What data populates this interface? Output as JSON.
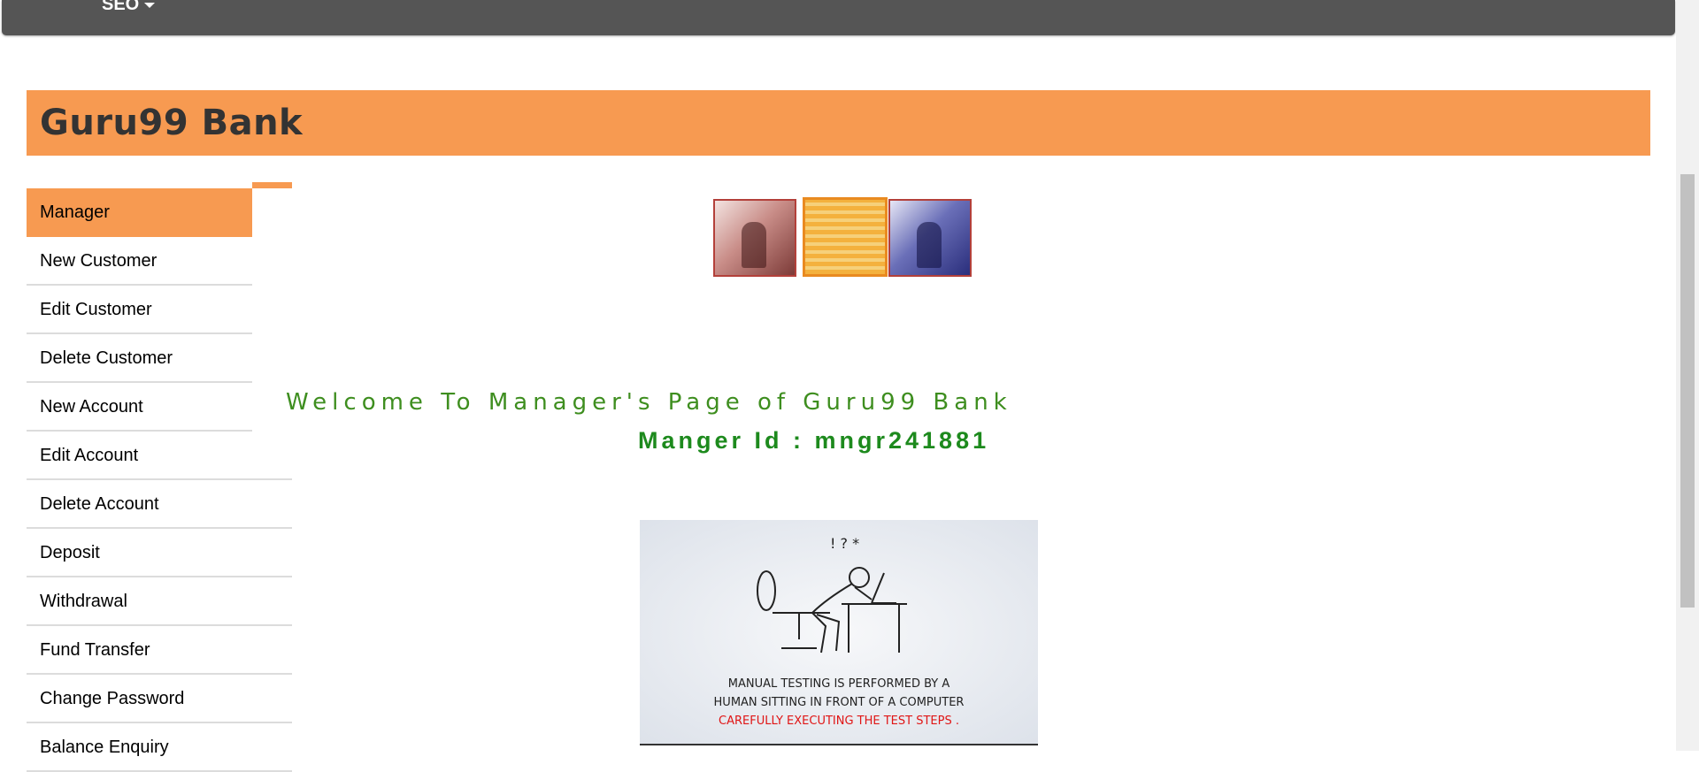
{
  "topnav": {
    "menu_label": "SEO"
  },
  "banner": {
    "brand": "Guru99 Bank"
  },
  "sidebar": {
    "items": [
      {
        "label": "Manager"
      },
      {
        "label": "New Customer"
      },
      {
        "label": "Edit Customer"
      },
      {
        "label": "Delete Customer"
      },
      {
        "label": "New Account"
      },
      {
        "label": "Edit Account"
      },
      {
        "label": "Delete Account"
      },
      {
        "label": "Deposit"
      },
      {
        "label": "Withdrawal"
      },
      {
        "label": "Fund Transfer"
      },
      {
        "label": "Change Password"
      },
      {
        "label": "Balance Enquiry"
      }
    ]
  },
  "main": {
    "welcome": "Welcome To Manager's Page of Guru99 Bank",
    "manager_id": "Manger Id : mngr241881",
    "illustration": {
      "caption_line1": "Manual testing is performed by a",
      "caption_line2": "human sitting in front of a computer",
      "caption_line3": "carefully executing the test steps ."
    }
  },
  "colors": {
    "accent": "#f79a51",
    "nav": "#555555",
    "welcome_green": "#3e8e1f",
    "id_green": "#1d8a1d"
  },
  "icons": {
    "menu_caret": "caret-down-icon"
  }
}
